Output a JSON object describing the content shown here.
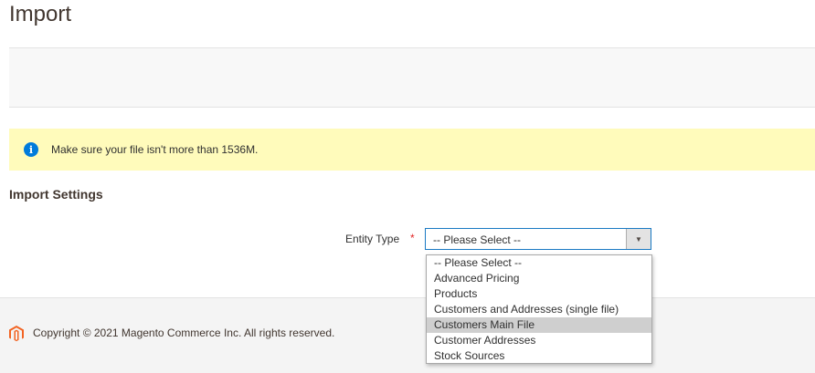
{
  "page": {
    "title": "Import"
  },
  "notice": {
    "icon": "info-icon",
    "text": "Make sure your file isn't more than 1536M."
  },
  "import_settings": {
    "section_title": "Import Settings",
    "entity_type": {
      "label": "Entity Type",
      "required_marker": "*",
      "current_value": "-- Please Select --",
      "options": [
        "-- Please Select --",
        "Advanced Pricing",
        "Products",
        "Customers and Addresses (single file)",
        "Customers Main File",
        "Customer Addresses",
        "Stock Sources"
      ],
      "highlighted_option": "Customers Main File"
    }
  },
  "footer": {
    "logo": "magento-logo-icon",
    "copyright": "Copyright © 2021 Magento Commerce Inc. All rights reserved."
  },
  "colors": {
    "notice_background": "#fffbbb",
    "info_icon": "#007bdb",
    "select_border": "#1979c3",
    "required_star": "#e22626",
    "highlight_option": "#cfcfcf",
    "magento_orange": "#f26322"
  }
}
